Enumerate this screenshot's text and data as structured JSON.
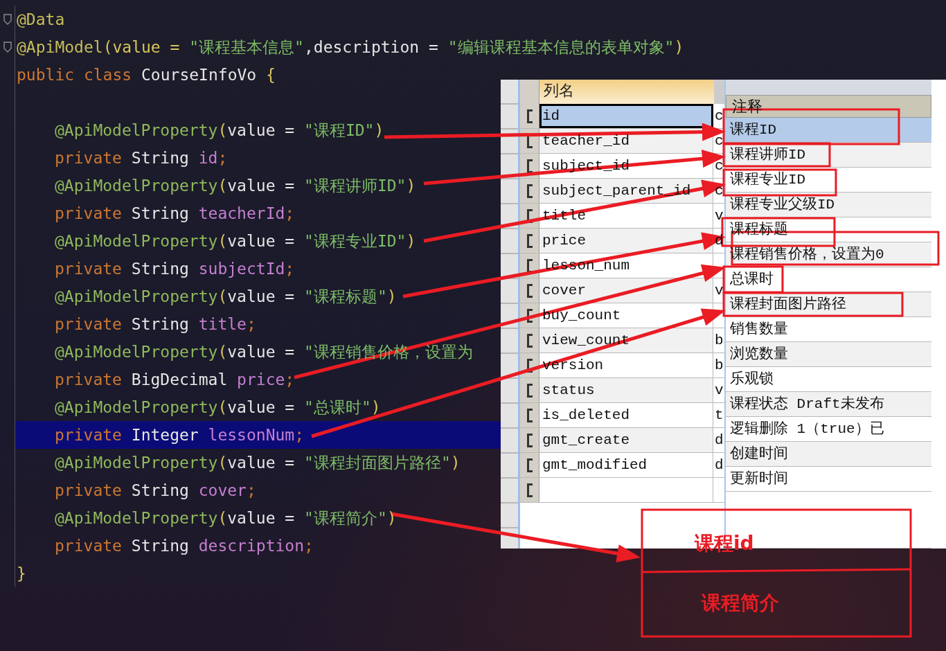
{
  "editor": {
    "header_lines": [
      {
        "fold": true,
        "tokens": [
          {
            "text": "@Data",
            "kind": "annotation"
          }
        ]
      },
      {
        "fold": true,
        "tokens": [
          {
            "text": "@ApiModel",
            "kind": "annotation"
          },
          {
            "text": "(value = ",
            "kind": "paren"
          },
          {
            "text": "\"课程基本信息\"",
            "kind": "string"
          },
          {
            "text": ",description = ",
            "kind": "plain"
          },
          {
            "text": "\"编辑课程基本信息的表单对象\"",
            "kind": "string"
          },
          {
            "text": ")",
            "kind": "paren"
          }
        ]
      },
      {
        "fold": false,
        "tokens": [
          {
            "text": "public class ",
            "kind": "keyword"
          },
          {
            "text": "CourseInfoVo ",
            "kind": "plain"
          },
          {
            "text": "{",
            "kind": "paren"
          }
        ]
      }
    ],
    "body_lines": [
      {
        "highlighted": false,
        "tokens": [
          {
            "text": "@ApiModelProperty",
            "kind": "property"
          },
          {
            "text": "(",
            "kind": "paren"
          },
          {
            "text": "value = ",
            "kind": "plain"
          },
          {
            "text": "\"课程ID\"",
            "kind": "string"
          },
          {
            "text": ")",
            "kind": "paren"
          }
        ]
      },
      {
        "highlighted": false,
        "tokens": [
          {
            "text": "private ",
            "kind": "keyword"
          },
          {
            "text": "String ",
            "kind": "plain"
          },
          {
            "text": "id",
            "kind": "field"
          },
          {
            "text": ";",
            "kind": "keyword"
          }
        ]
      },
      {
        "highlighted": false,
        "tokens": [
          {
            "text": "@ApiModelProperty",
            "kind": "property"
          },
          {
            "text": "(",
            "kind": "paren"
          },
          {
            "text": "value = ",
            "kind": "plain"
          },
          {
            "text": "\"课程讲师ID\"",
            "kind": "string"
          },
          {
            "text": ")",
            "kind": "paren"
          }
        ]
      },
      {
        "highlighted": false,
        "tokens": [
          {
            "text": "private ",
            "kind": "keyword"
          },
          {
            "text": "String ",
            "kind": "plain"
          },
          {
            "text": "teacherId",
            "kind": "field"
          },
          {
            "text": ";",
            "kind": "keyword"
          }
        ]
      },
      {
        "highlighted": false,
        "tokens": [
          {
            "text": "@ApiModelProperty",
            "kind": "property"
          },
          {
            "text": "(",
            "kind": "paren"
          },
          {
            "text": "value = ",
            "kind": "plain"
          },
          {
            "text": "\"课程专业ID\"",
            "kind": "string"
          },
          {
            "text": ")",
            "kind": "paren"
          }
        ]
      },
      {
        "highlighted": false,
        "tokens": [
          {
            "text": "private ",
            "kind": "keyword"
          },
          {
            "text": "String ",
            "kind": "plain"
          },
          {
            "text": "subjectId",
            "kind": "field"
          },
          {
            "text": ";",
            "kind": "keyword"
          }
        ]
      },
      {
        "highlighted": false,
        "tokens": [
          {
            "text": "@ApiModelProperty",
            "kind": "property"
          },
          {
            "text": "(",
            "kind": "paren"
          },
          {
            "text": "value = ",
            "kind": "plain"
          },
          {
            "text": "\"课程标题\"",
            "kind": "string"
          },
          {
            "text": ")",
            "kind": "paren"
          }
        ]
      },
      {
        "highlighted": false,
        "tokens": [
          {
            "text": "private ",
            "kind": "keyword"
          },
          {
            "text": "String ",
            "kind": "plain"
          },
          {
            "text": "title",
            "kind": "field"
          },
          {
            "text": ";",
            "kind": "keyword"
          }
        ]
      },
      {
        "highlighted": false,
        "tokens": [
          {
            "text": "@ApiModelProperty",
            "kind": "property"
          },
          {
            "text": "(",
            "kind": "paren"
          },
          {
            "text": "value = ",
            "kind": "plain"
          },
          {
            "text": "\"课程销售价格，设置为",
            "kind": "string"
          }
        ]
      },
      {
        "highlighted": false,
        "tokens": [
          {
            "text": "private ",
            "kind": "keyword"
          },
          {
            "text": "BigDecimal ",
            "kind": "plain"
          },
          {
            "text": "price",
            "kind": "field"
          },
          {
            "text": ";",
            "kind": "keyword"
          }
        ]
      },
      {
        "highlighted": false,
        "tokens": [
          {
            "text": "@ApiModelProperty",
            "kind": "property"
          },
          {
            "text": "(",
            "kind": "paren"
          },
          {
            "text": "value = ",
            "kind": "plain"
          },
          {
            "text": "\"总课时\"",
            "kind": "string"
          },
          {
            "text": ")",
            "kind": "paren"
          }
        ]
      },
      {
        "highlighted": true,
        "tokens": [
          {
            "text": "private ",
            "kind": "keyword"
          },
          {
            "text": "Integer ",
            "kind": "plain"
          },
          {
            "text": "lessonNum",
            "kind": "field"
          },
          {
            "text": ";",
            "kind": "keyword"
          }
        ]
      },
      {
        "highlighted": false,
        "tokens": [
          {
            "text": "@ApiModelProperty",
            "kind": "property"
          },
          {
            "text": "(",
            "kind": "paren"
          },
          {
            "text": "value = ",
            "kind": "plain"
          },
          {
            "text": "\"课程封面图片路径\"",
            "kind": "string"
          },
          {
            "text": ")",
            "kind": "paren"
          }
        ]
      },
      {
        "highlighted": false,
        "tokens": [
          {
            "text": "private ",
            "kind": "keyword"
          },
          {
            "text": "String ",
            "kind": "plain"
          },
          {
            "text": "cover",
            "kind": "field"
          },
          {
            "text": ";",
            "kind": "keyword"
          }
        ]
      },
      {
        "highlighted": false,
        "tokens": [
          {
            "text": "@ApiModelProperty",
            "kind": "property"
          },
          {
            "text": "(",
            "kind": "paren"
          },
          {
            "text": "value = ",
            "kind": "plain"
          },
          {
            "text": "\"课程简介\"",
            "kind": "string"
          },
          {
            "text": ")",
            "kind": "paren"
          }
        ]
      },
      {
        "highlighted": false,
        "tokens": [
          {
            "text": "private ",
            "kind": "keyword"
          },
          {
            "text": "String ",
            "kind": "plain"
          },
          {
            "text": "description",
            "kind": "field"
          },
          {
            "text": ";",
            "kind": "keyword"
          }
        ]
      }
    ],
    "closing_line": "}"
  },
  "table": {
    "columns": {
      "name": "列名",
      "comment": "注释"
    },
    "rows": [
      {
        "name": "id",
        "type": "c",
        "comment": "课程ID",
        "selected": true
      },
      {
        "name": "teacher_id",
        "type": "c",
        "comment": "课程讲师ID",
        "selected": false
      },
      {
        "name": "subject_id",
        "type": "c",
        "comment": "课程专业ID",
        "selected": false
      },
      {
        "name": "subject_parent_id",
        "type": "c",
        "comment": "课程专业父级ID",
        "selected": false
      },
      {
        "name": "title",
        "type": "v",
        "comment": "课程标题",
        "selected": false
      },
      {
        "name": "price",
        "type": "d",
        "comment": "课程销售价格，设置为0",
        "selected": false
      },
      {
        "name": "lesson_num",
        "comment": "总课时",
        "selected": false
      },
      {
        "name": "cover",
        "type": "v",
        "comment": "课程封面图片路径",
        "selected": false
      },
      {
        "name": "buy_count",
        "comment": "销售数量",
        "selected": false
      },
      {
        "name": "view_count",
        "type": "b",
        "comment": "浏览数量",
        "selected": false
      },
      {
        "name": "version",
        "type": "b",
        "comment": "乐观锁",
        "selected": false
      },
      {
        "name": "status",
        "type": "v",
        "comment": "课程状态 Draft未发布",
        "selected": false
      },
      {
        "name": "is_deleted",
        "type": "t",
        "comment": "逻辑删除 1（true）已",
        "selected": false
      },
      {
        "name": "gmt_create",
        "type": "d",
        "comment": "创建时间",
        "selected": false
      },
      {
        "name": "gmt_modified",
        "type": "d",
        "comment": "更新时间",
        "selected": false
      }
    ]
  },
  "annotation": {
    "labels": [
      "课程id",
      "课程简介"
    ]
  }
}
